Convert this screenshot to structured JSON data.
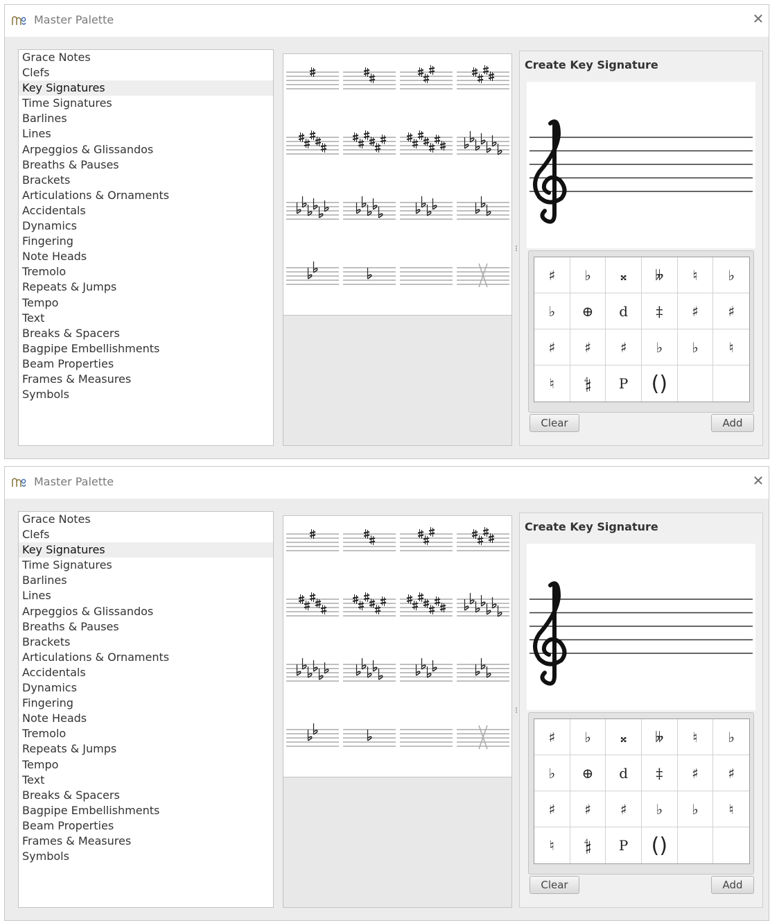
{
  "window_title": "Master Palette",
  "categories": [
    "Grace Notes",
    "Clefs",
    "Key Signatures",
    "Time Signatures",
    "Barlines",
    "Lines",
    "Arpeggios & Glissandos",
    "Breaths & Pauses",
    "Brackets",
    "Articulations & Ornaments",
    "Accidentals",
    "Dynamics",
    "Fingering",
    "Note Heads",
    "Tremolo",
    "Repeats & Jumps",
    "Tempo",
    "Text",
    "Breaks & Spacers",
    "Bagpipe Embellishments",
    "Beam Properties",
    "Frames & Measures",
    "Symbols"
  ],
  "selected_category": "Key Signatures",
  "key_signatures": [
    {
      "type": "sharp",
      "count": 1
    },
    {
      "type": "sharp",
      "count": 2
    },
    {
      "type": "sharp",
      "count": 3
    },
    {
      "type": "sharp",
      "count": 4
    },
    {
      "type": "sharp",
      "count": 5
    },
    {
      "type": "sharp",
      "count": 6
    },
    {
      "type": "sharp",
      "count": 7
    },
    {
      "type": "flat",
      "count": 7
    },
    {
      "type": "flat",
      "count": 6
    },
    {
      "type": "flat",
      "count": 5
    },
    {
      "type": "flat",
      "count": 4
    },
    {
      "type": "flat",
      "count": 3
    },
    {
      "type": "flat",
      "count": 2
    },
    {
      "type": "flat",
      "count": 1
    },
    {
      "type": "none",
      "count": 0
    },
    {
      "type": "open",
      "count": 0
    }
  ],
  "create_panel": {
    "title": "Create Key Signature",
    "accidentals": [
      "♯",
      "♭",
      "𝄪",
      "𝄫",
      "♮",
      "♭",
      "♭",
      "⊕",
      "d",
      "‡",
      "♯",
      "♯",
      "♯",
      "♯",
      "♯",
      "♭",
      "♭",
      "♮",
      "♮",
      "𝄲",
      "P",
      "()",
      "",
      ""
    ],
    "accidental_icons": [
      "sharp",
      "flat",
      "double-sharp",
      "double-flat",
      "natural",
      "flat-slash",
      "flat-double-slash",
      "mirrored-flat-slash",
      "mirrored-flat",
      "sharp-slash",
      "sharp-slash-3",
      "sharp-slash-4",
      "sharp-arrow-up",
      "sharp-arrow-down",
      "sharp-arrow-both",
      "flat-arrow-up",
      "flat-arrow-down",
      "natural-arrow-up",
      "natural-arrow-down",
      "sharp-slash-2",
      "flat-flat-slash",
      "parentheses",
      "empty",
      "empty"
    ],
    "clear_label": "Clear",
    "add_label": "Add"
  }
}
